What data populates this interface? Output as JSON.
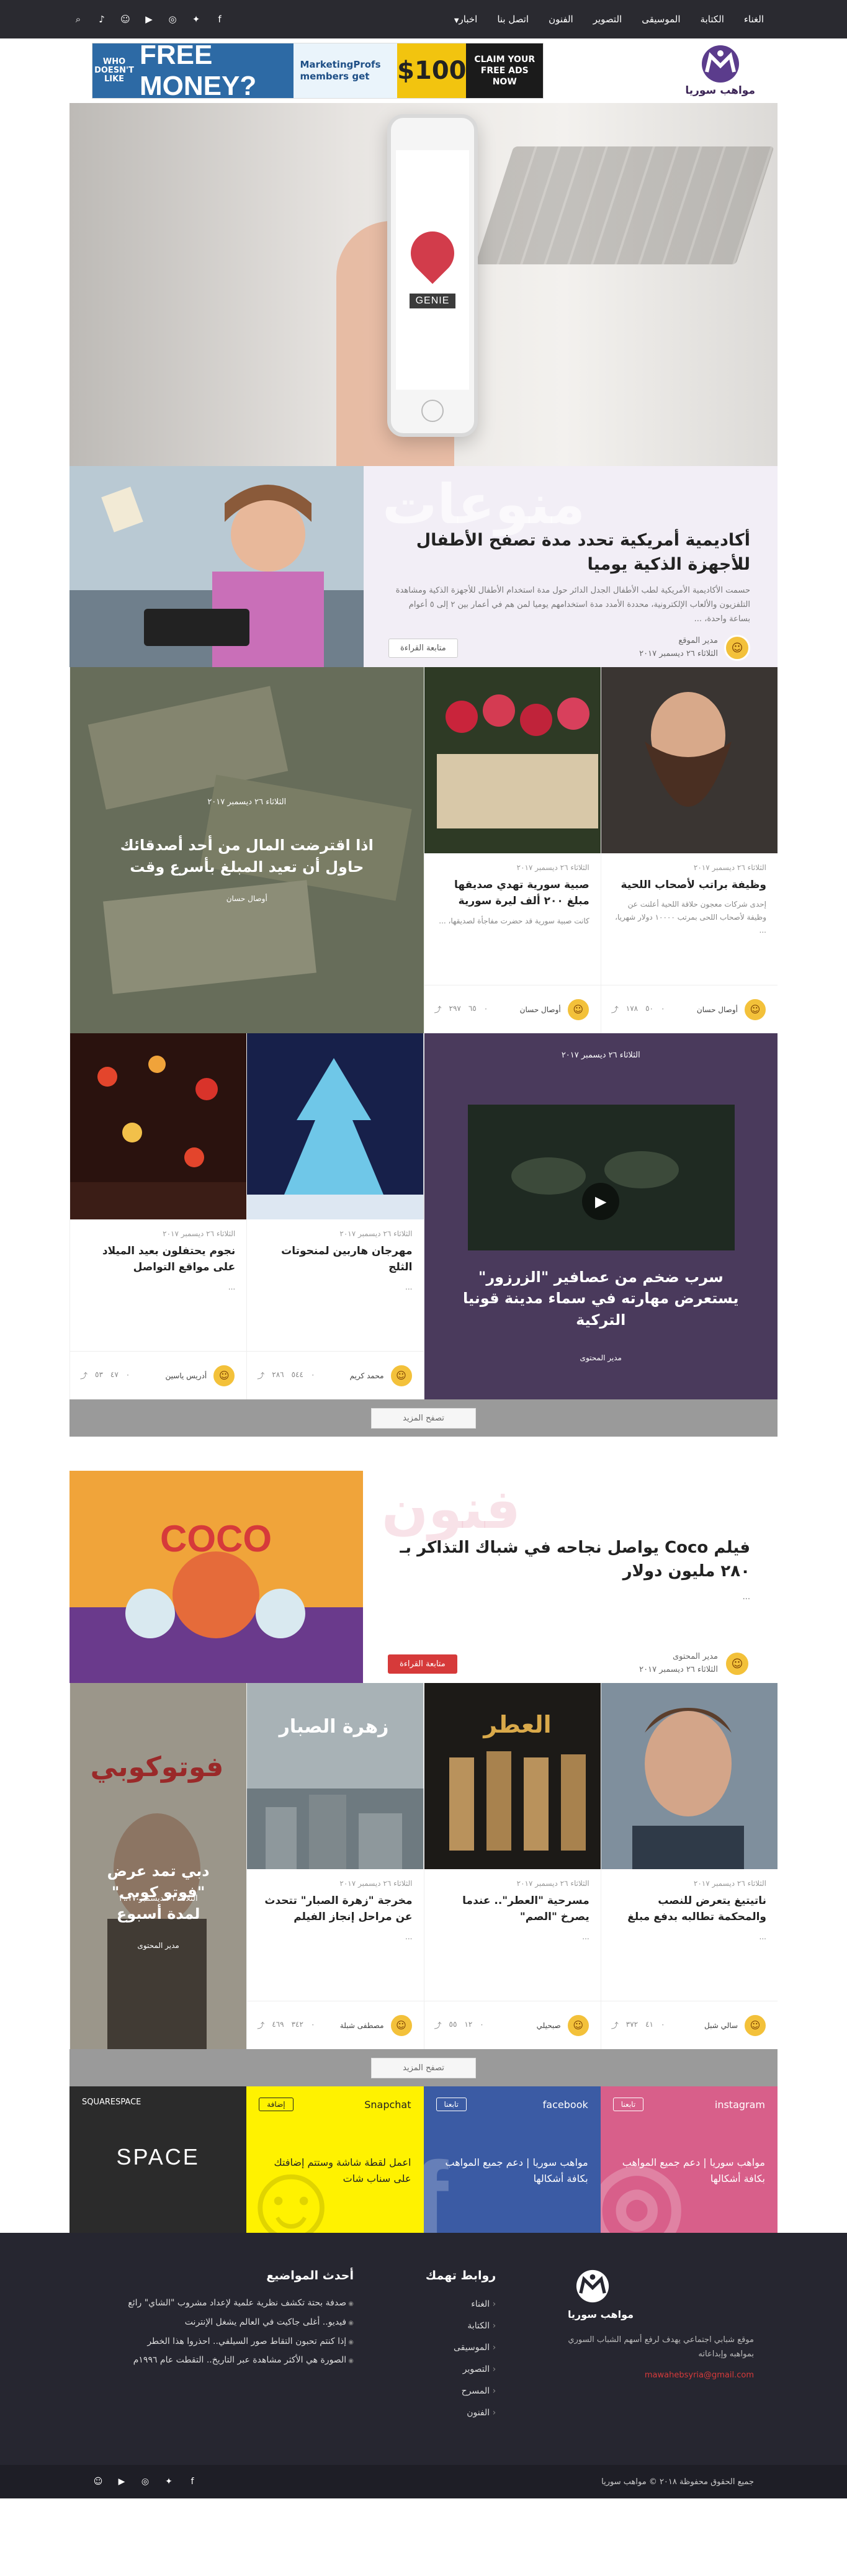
{
  "nav": {
    "items": [
      "الغناء",
      "الكتابة",
      "الموسيقى",
      "التصوير",
      "الفنون",
      "اتصل بنا",
      "اخبار"
    ],
    "social": [
      "facebook-icon",
      "twitter-icon",
      "instagram-icon",
      "youtube-icon",
      "user-icon",
      "bell-icon",
      "search-icon"
    ]
  },
  "header": {
    "logo_text": "مواهب سوريا",
    "ad": {
      "part1": "WHO DOESN'T LIKE",
      "part2": "FREE MONEY?",
      "part3": "MarketingProfs members get",
      "part4": "$100",
      "part5": "CLAIM YOUR FREE ADS NOW"
    }
  },
  "hero": {
    "label": "GENIE"
  },
  "featured1": {
    "tag": "منوعات",
    "title": "أكاديمية أمريكية تحدد مدة تصفح الأطفال للأجهزة الذكية يوميا",
    "excerpt": "حسمت الأكاديمية الأمريكية لطب الأطفال الجدل الدائر حول مدة استخدام الأطفال للأجهزة الذكية ومشاهدة التلفزيون والألعاب الإلكترونية، محددة الأمدد مدة استخدامهم يوميا لمن هم في أعمار بين ٢ إلى ٥ أعوام بساعة واحدة، ...",
    "author": "مدير الموقع",
    "date": "الثلاثاء ٢٦ ديسمبر ٢٠١٧",
    "read_more": "متابعة القراءة"
  },
  "grid1": [
    {
      "type": "card",
      "date": "الثلاثاء ٢٦ ديسمبر ٢٠١٧",
      "title": "وظيفة براتب لأصحاب اللحية",
      "excerpt": "إحدى شركات معجون حلاقة اللحية أعلنت عن وظيفة لأصحاب اللحى بمرتب ١٠٠٠٠ دولار شهريا، ...",
      "author": "أوصال حسان",
      "stats": {
        "comments": "٠",
        "likes": "٥٠",
        "views": "١٧٨"
      }
    },
    {
      "type": "card",
      "date": "الثلاثاء ٢٦ ديسمبر ٢٠١٧",
      "title": "صبية سورية تهدي صديقها مبلغ ٢٠٠ ألف ليرة سورية",
      "excerpt": "كانت صبية سورية قد حضرت مفاجأة لصديقها، ...",
      "author": "أوصال حسان",
      "stats": {
        "comments": "٠",
        "likes": "٦٥",
        "views": "٢٩٧"
      }
    },
    {
      "type": "overlay",
      "title": "اذا اقترضت المال من أحد أصدقائك حاول أن تعيد المبلغ بأسرع وقت",
      "author": "أوصال حسان",
      "date": "الثلاثاء ٢٦ ديسمبر ٢٠١٧"
    }
  ],
  "grid2": [
    {
      "type": "video",
      "title": "سرب ضخم من عصافير \"الزرزور\" يستعرض مهارته في سماء مدينة قونيا التركية",
      "author": "مدير المحتوى",
      "date": "الثلاثاء ٢٦ ديسمبر ٢٠١٧"
    },
    {
      "type": "card",
      "date": "الثلاثاء ٢٦ ديسمبر ٢٠١٧",
      "title": "مهرجان هاربين لمنحوتات الثلج",
      "excerpt": "...",
      "author": "محمد كريم",
      "stats": {
        "comments": "٠",
        "likes": "٥٤٤",
        "views": "٢٨٦"
      }
    },
    {
      "type": "card",
      "date": "الثلاثاء ٢٦ ديسمبر ٢٠١٧",
      "title": "نجوم يحتفلون بعيد الميلاد على مواقع التواصل",
      "excerpt": "...",
      "author": "أدريس ياسين",
      "stats": {
        "comments": "٠",
        "likes": "٤٧",
        "views": "٥٣"
      }
    }
  ],
  "more_label": "تصفح المزيد",
  "featured2": {
    "tag": "فنون",
    "title": "فيلم Coco يواصل نجاحه في شباك التذاكر بـ ٢٨٠ مليون دولار",
    "excerpt": "...",
    "author": "مدير المحتوى",
    "date": "الثلاثاء ٢٦ ديسمبر ٢٠١٧",
    "read_more": "متابعة القراءة"
  },
  "grid3": [
    {
      "type": "card",
      "date": "الثلاثاء ٢٦ ديسمبر ٢٠١٧",
      "title": "ناتيتيغ يتعرض للنصب والمحكمة تطالبه بدفع مبلغ",
      "excerpt": "...",
      "author": "سالي شبل",
      "stats": {
        "comments": "٠",
        "likes": "٤١",
        "views": "٣٧٢"
      }
    },
    {
      "type": "card",
      "date": "الثلاثاء ٢٦ ديسمبر ٢٠١٧",
      "title": "مسرحية \"العطر\".. عندما يصرخ \"الصم\"",
      "excerpt": "...",
      "author": "صبحيلي",
      "stats": {
        "comments": "٠",
        "likes": "١٢",
        "views": "٥٥"
      }
    },
    {
      "type": "card",
      "date": "الثلاثاء ٢٦ ديسمبر ٢٠١٧",
      "title": "مخرجة \"زهرة الصبار\" تتحدث عن مراحل إنجاز الفيلم",
      "excerpt": "...",
      "author": "مصطفى شبلة",
      "stats": {
        "comments": "٠",
        "likes": "٣٤٢",
        "views": "٤٦٩"
      }
    },
    {
      "type": "overlay",
      "title": "دبي تمد عرض \"فوتو كوبي\" لمدة أسبوع",
      "author": "مدير المحتوى",
      "date": "الثلاثاء ٢٦ ديسمبر ٢٠١٧"
    }
  ],
  "socials": {
    "instagram": {
      "name": "instagram",
      "follow": "تابعنا",
      "text": "مواهب سوريا | دعم جميع المواهب بكافة أشكالها"
    },
    "facebook": {
      "name": "facebook",
      "follow": "تابعنا",
      "text": "مواهب سوريا | دعم جميع المواهب بكافة أشكالها"
    },
    "snapchat": {
      "name": "Snapchat",
      "follow": "إضافة",
      "text": "اعمل لقطة شاشة وستتم إضافتك على سناب شات"
    },
    "ad": {
      "brand": "SQUARESPACE",
      "headline": "SPACE"
    }
  },
  "footer": {
    "logo_text": "مواهب سوريا",
    "about": "موقع شبابي اجتماعي يهدف لرفع أسهم الشباب السوري بمواهبه وإبداعاته",
    "email": "mawahebsyria@gmail.com",
    "links_title": "روابط تهمك",
    "links": [
      "الغناء",
      "الكتابة",
      "الموسيقى",
      "التصوير",
      "المسرح",
      "الفنون"
    ],
    "recent_title": "أحدث المواضيع",
    "recent": [
      "صدفة بحتة تكشف نظرية علمية لإعداد مشروب \"الشاي\" رائع",
      "فيديو.. أغلى جاكيت في العالم يشغل الإنترنت",
      "إذا كنتم تحبون التقاط صور السيلفي.. احذروا هذا الخطر",
      "الصورة هي الأكثر مشاهدة عبر التاريخ.. التقطت عام ١٩٩٦م"
    ],
    "copyright": "جميع الحقوق محفوظة ٢٠١٨ © مواهب سوريا"
  }
}
